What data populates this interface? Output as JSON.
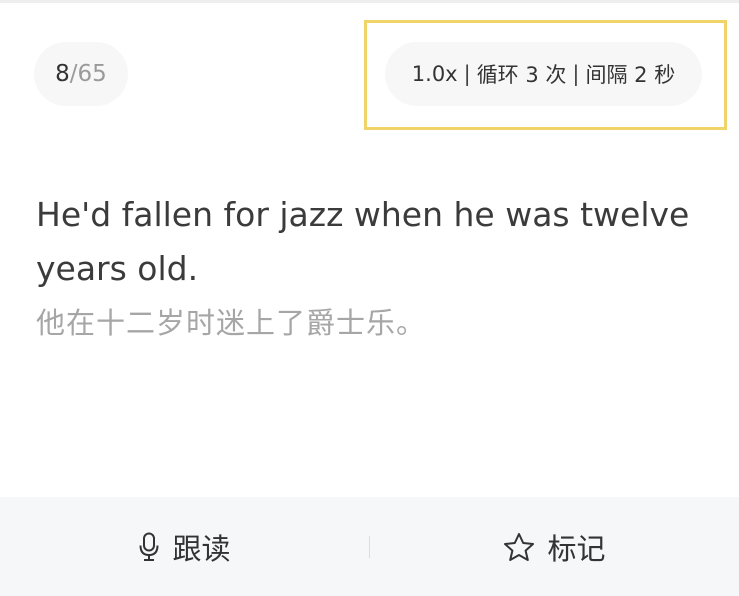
{
  "progress": {
    "current": "8",
    "separator": "/",
    "total": "65"
  },
  "playback": {
    "speed": "1.0x",
    "divider": "|",
    "loop": "循环 3 次",
    "interval": "间隔 2 秒"
  },
  "content": {
    "sentence": "He'd fallen for jazz when he was twelve years old.",
    "translation": "他在十二岁时迷上了爵士乐。"
  },
  "actions": {
    "follow_read_label": "跟读",
    "follow_read_icon": "microphone-icon",
    "mark_label": "标记",
    "mark_icon": "star-icon"
  },
  "colors": {
    "highlight_border": "#f0d46a",
    "pill_background": "#f7f7f7",
    "bottom_bar_background": "#f6f7f9"
  }
}
